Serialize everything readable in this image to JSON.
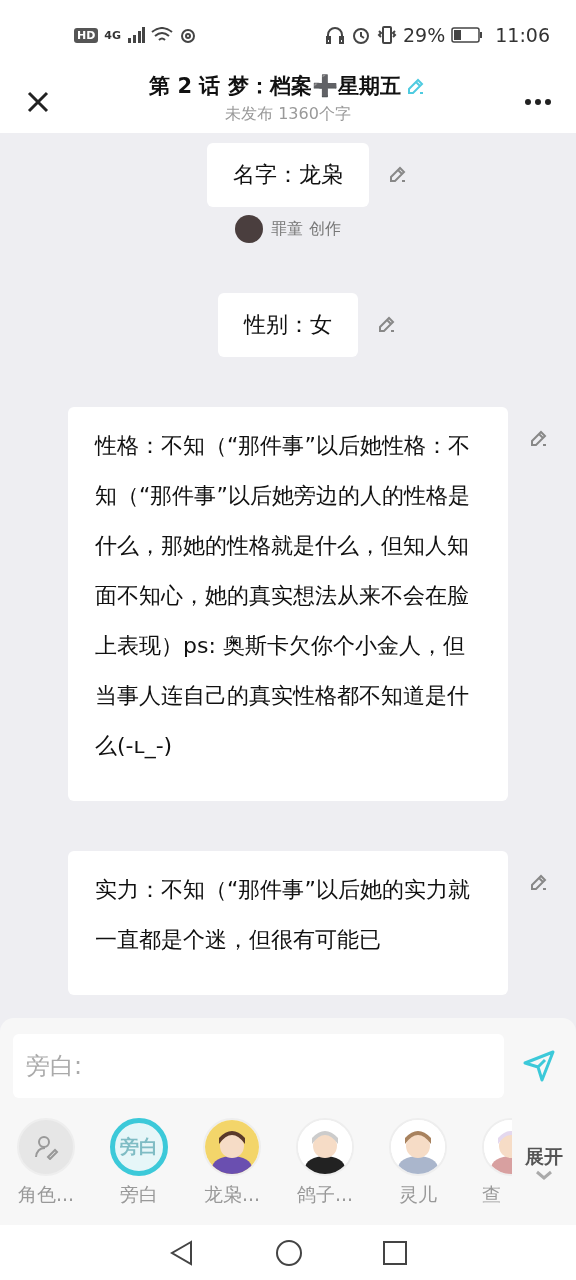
{
  "status_bar": {
    "left": [
      "HD",
      "4G"
    ],
    "battery_text": "29%",
    "time": "11:06"
  },
  "header": {
    "title": "第 2 话 梦：档案➕星期五",
    "subtitle": "未发布 1360个字"
  },
  "messages": [
    {
      "kind": "short",
      "text": "名字：龙枭",
      "author": "罪童 创作"
    },
    {
      "kind": "short",
      "text": "性别：女"
    },
    {
      "kind": "long",
      "text": "性格：不知（“那件事”以后她性格：不知（“那件事”以后她旁边的人的性格是什么，那她的性格就是什么，但知人知面不知心，她的真实想法从来不会在脸上表现）ps: 奥斯卡欠你个小金人，但当事人连自己的真实性格都不知道是什么(-ʟ_-)"
    },
    {
      "kind": "long",
      "text": "实力：不知（“那件事”以后她的实力就一直都是个迷，但很有可能已"
    }
  ],
  "composer": {
    "placeholder": "旁白:"
  },
  "characters": [
    {
      "kind": "add",
      "name": "角色...",
      "selected": false
    },
    {
      "kind": "narrator",
      "badge": "旁白",
      "name": "旁白",
      "selected": true
    },
    {
      "kind": "picture",
      "name": "龙枭...",
      "selected": false
    },
    {
      "kind": "picture",
      "name": "鸽子...",
      "selected": false
    },
    {
      "kind": "picture",
      "name": "灵儿",
      "selected": false
    },
    {
      "kind": "picture",
      "name": "查",
      "selected": false
    }
  ],
  "expand": {
    "label": "展开"
  }
}
